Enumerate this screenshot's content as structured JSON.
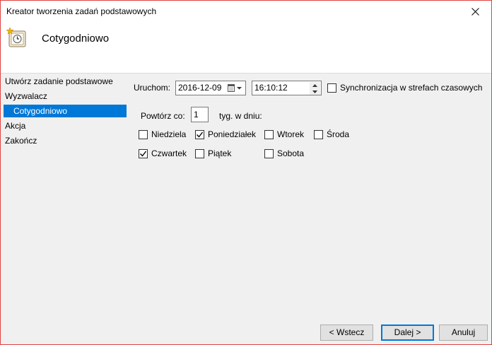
{
  "window": {
    "title": "Kreator tworzenia zadań podstawowych"
  },
  "header": {
    "title": "Cotygodniowo"
  },
  "nav": {
    "items": [
      {
        "label": "Utwórz zadanie podstawowe",
        "selected": false
      },
      {
        "label": "Wyzwalacz",
        "selected": false
      },
      {
        "label": "Cotygodniowo",
        "selected": true
      },
      {
        "label": "Akcja",
        "selected": false
      },
      {
        "label": "Zakończ",
        "selected": false
      }
    ]
  },
  "start": {
    "label": "Uruchom:",
    "date": "2016-12-09",
    "time": "16:10:12",
    "sync_label": "Synchronizacja w strefach czasowych",
    "sync_checked": false
  },
  "repeat": {
    "label": "Powtórz co:",
    "value": "1",
    "suffix": "tyg. w dniu:"
  },
  "days": [
    {
      "label": "Niedziela",
      "checked": false
    },
    {
      "label": "Poniedziałek",
      "checked": true
    },
    {
      "label": "Wtorek",
      "checked": false
    },
    {
      "label": "Środa",
      "checked": false
    },
    {
      "label": "Czwartek",
      "checked": true
    },
    {
      "label": "Piątek",
      "checked": false
    },
    {
      "label": "Sobota",
      "checked": false
    }
  ],
  "buttons": {
    "back": "< Wstecz",
    "next": "Dalej >",
    "cancel": "Anuluj"
  },
  "colors": {
    "accent": "#0078d7",
    "window_border": "#e04343",
    "panel": "#f0f0f0"
  }
}
